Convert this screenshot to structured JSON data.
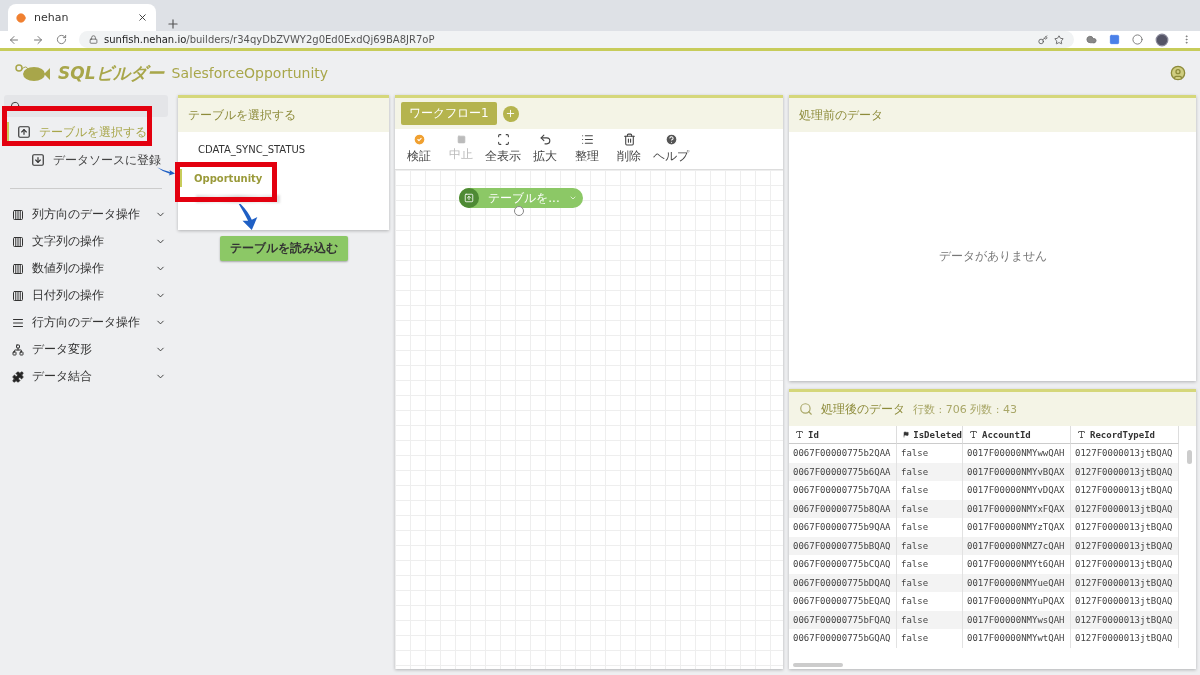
{
  "browser": {
    "tab_title": "nehan",
    "url_host": "sunfish.nehan.io",
    "url_path": "/builders/r34qyDbZVWY2g0Ed0ExdQj69BA8JR7oP"
  },
  "app": {
    "logo": "SQLビルダー",
    "title": "SalesforceOpportunity"
  },
  "sidebar": {
    "actions": [
      {
        "label": "テーブルを選択する",
        "selected": true,
        "kind": "import"
      },
      {
        "label": "データソースに登録",
        "selected": false,
        "kind": "export"
      }
    ],
    "categories": [
      {
        "label": "列方向のデータ操作",
        "kind": "columns"
      },
      {
        "label": "文字列の操作",
        "kind": "columns"
      },
      {
        "label": "数値列の操作",
        "kind": "columns"
      },
      {
        "label": "日付列の操作",
        "kind": "columns"
      },
      {
        "label": "行方向のデータ操作",
        "kind": "rows"
      },
      {
        "label": "データ変形",
        "kind": "transform"
      },
      {
        "label": "データ結合",
        "kind": "merge"
      }
    ]
  },
  "table_picker": {
    "title": "テーブルを選択する",
    "tables": [
      {
        "name": "CDATA_SYNC_STATUS",
        "selected": false
      },
      {
        "name": "Opportunity",
        "selected": true
      }
    ],
    "button": "テーブルを読み込む"
  },
  "workflow": {
    "tabs": [
      {
        "label": "ワークフロー1",
        "selected": true
      }
    ],
    "tools": [
      {
        "label": "検証",
        "kind": "check",
        "disabled": false
      },
      {
        "label": "中止",
        "kind": "stop",
        "disabled": true
      },
      {
        "label": "全表示",
        "kind": "fit",
        "disabled": false
      },
      {
        "label": "拡大",
        "kind": "undo",
        "disabled": false
      },
      {
        "label": "整理",
        "kind": "list",
        "disabled": false
      },
      {
        "label": "削除",
        "kind": "trash",
        "disabled": false
      },
      {
        "label": "ヘルプ",
        "kind": "help",
        "disabled": false
      }
    ],
    "node": "テーブルを..."
  },
  "pre_data": {
    "title": "処理前のデータ",
    "empty": "データがありません"
  },
  "post_data": {
    "title": "処理後のデータ",
    "stats": "行数 : 706 列数 : 43",
    "columns": [
      {
        "label": "Id",
        "kind": "text"
      },
      {
        "label": "IsDeleted",
        "kind": "flag"
      },
      {
        "label": "AccountId",
        "kind": "text"
      },
      {
        "label": "RecordTypeId",
        "kind": "text"
      }
    ],
    "rows": [
      [
        "0067F00000775b2QAA",
        "false",
        "0017F00000NMYwwQAH",
        "0127F0000013jtBQAQ"
      ],
      [
        "0067F00000775b6QAA",
        "false",
        "0017F00000NMYvBQAX",
        "0127F0000013jtBQAQ"
      ],
      [
        "0067F00000775b7QAA",
        "false",
        "0017F00000NMYvDQAX",
        "0127F0000013jtBQAQ"
      ],
      [
        "0067F00000775b8QAA",
        "false",
        "0017F00000NMYxFQAX",
        "0127F0000013jtBQAQ"
      ],
      [
        "0067F00000775b9QAA",
        "false",
        "0017F00000NMYzTQAX",
        "0127F0000013jtBQAQ"
      ],
      [
        "0067F00000775bBQAQ",
        "false",
        "0017F00000NMZ7cQAH",
        "0127F0000013jtBQAQ"
      ],
      [
        "0067F00000775bCQAQ",
        "false",
        "0017F00000NMYt6QAH",
        "0127F0000013jtBQAQ"
      ],
      [
        "0067F00000775bDQAQ",
        "false",
        "0017F00000NMYueQAH",
        "0127F0000013jtBQAQ"
      ],
      [
        "0067F00000775bEQAQ",
        "false",
        "0017F00000NMYuPQAX",
        "0127F0000013jtBQAQ"
      ],
      [
        "0067F00000775bFQAQ",
        "false",
        "0017F00000NMYwsQAH",
        "0127F0000013jtBQAQ"
      ],
      [
        "0067F00000775bGQAQ",
        "false",
        "0017F00000NMYwtQAH",
        "0127F0000013jtBQAQ"
      ]
    ]
  }
}
